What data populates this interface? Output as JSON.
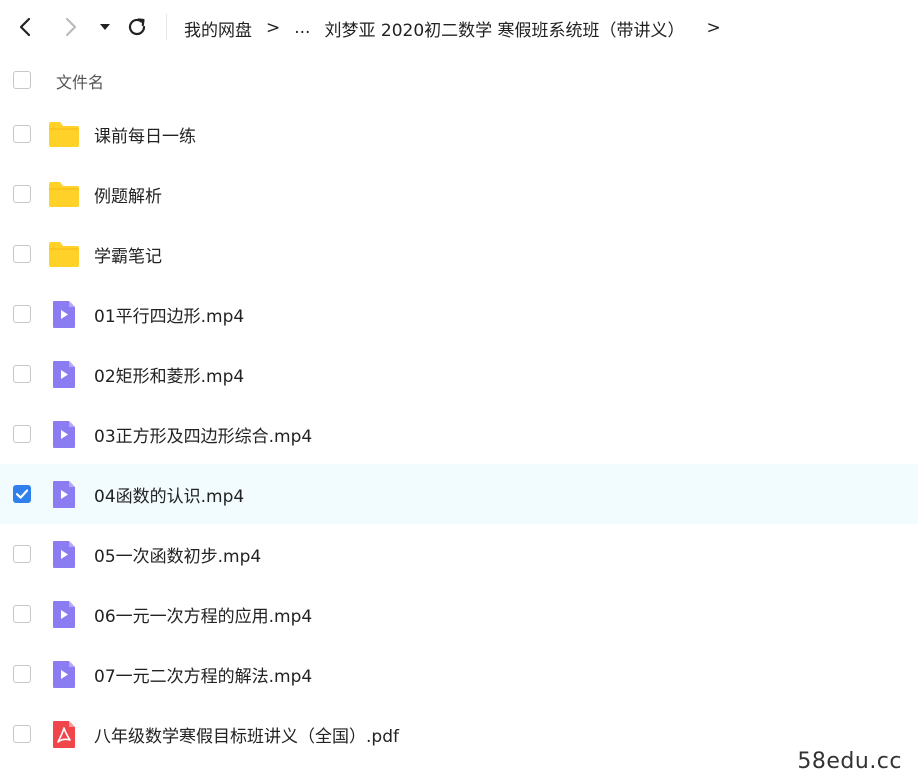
{
  "toolbar": {
    "back_icon": "chevron-left-icon",
    "forward_icon": "chevron-right-icon",
    "dropdown_icon": "caret-down-icon",
    "refresh_icon": "refresh-icon"
  },
  "breadcrumb": {
    "root": "我的网盘",
    "sep1": ">",
    "ellipsis": "...",
    "current": "刘梦亚 2020初二数学 寒假班系统班（带讲义）",
    "sep2": ">"
  },
  "list_header": {
    "name_label": "文件名"
  },
  "files": [
    {
      "name": "课前每日一练",
      "type": "folder",
      "checked": false
    },
    {
      "name": "例题解析",
      "type": "folder",
      "checked": false
    },
    {
      "name": "学霸笔记",
      "type": "folder",
      "checked": false
    },
    {
      "name": "01平行四边形.mp4",
      "type": "video",
      "checked": false
    },
    {
      "name": "02矩形和菱形.mp4",
      "type": "video",
      "checked": false
    },
    {
      "name": "03正方形及四边形综合.mp4",
      "type": "video",
      "checked": false
    },
    {
      "name": "04函数的认识.mp4",
      "type": "video",
      "checked": true
    },
    {
      "name": "05一次函数初步.mp4",
      "type": "video",
      "checked": false
    },
    {
      "name": "06一元一次方程的应用.mp4",
      "type": "video",
      "checked": false
    },
    {
      "name": "07一元二次方程的解法.mp4",
      "type": "video",
      "checked": false
    },
    {
      "name": "八年级数学寒假目标班讲义（全国）.pdf",
      "type": "pdf",
      "checked": false
    }
  ],
  "colors": {
    "folder": "#ffd129",
    "video": "#8b7cf2",
    "pdf": "#f0464b",
    "check": "#2f80ed",
    "selected_row": "#f2fbfd"
  },
  "watermark": "58edu.cc"
}
